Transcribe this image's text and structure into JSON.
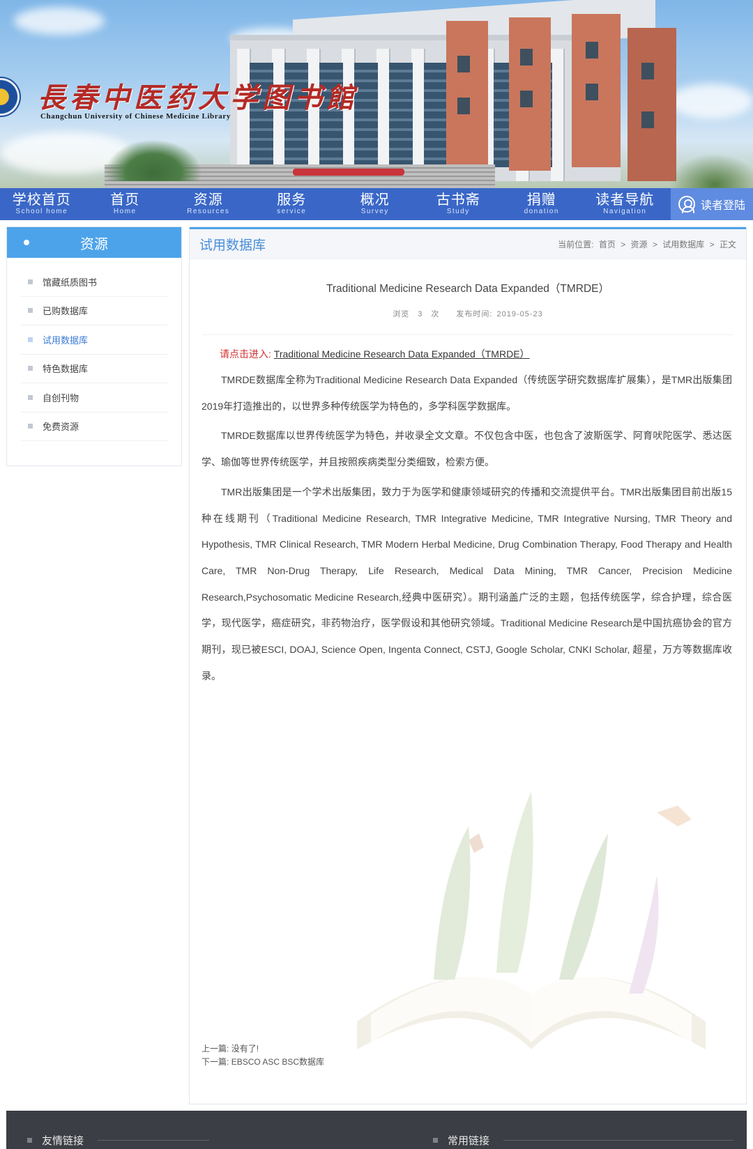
{
  "header": {
    "logo_title": "長春中医药大学图书館",
    "logo_subtitle": "Changchun University of Chinese Medicine Library"
  },
  "nav": {
    "items": [
      {
        "zh": "学校首页",
        "en": "School home"
      },
      {
        "zh": "首页",
        "en": "Home"
      },
      {
        "zh": "资源",
        "en": "Resources"
      },
      {
        "zh": "服务",
        "en": "service"
      },
      {
        "zh": "概况",
        "en": "Survey"
      },
      {
        "zh": "古书斋",
        "en": "Study"
      },
      {
        "zh": "捐赠",
        "en": "donation"
      },
      {
        "zh": "读者导航",
        "en": "Navigation"
      }
    ],
    "login_label": "读者登陆"
  },
  "sidebar": {
    "title": "资源",
    "items": [
      {
        "label": "馆藏纸质图书"
      },
      {
        "label": "已购数据库"
      },
      {
        "label": "试用数据库"
      },
      {
        "label": "特色数据库"
      },
      {
        "label": "自创刊物"
      },
      {
        "label": "免费资源"
      }
    ],
    "active_index": 2
  },
  "main": {
    "section_title": "试用数据库",
    "breadcrumb": {
      "label": "当前位置:",
      "home": "首页",
      "sep": ">",
      "resources": "资源",
      "trial_db": "试用数据库",
      "current": "正文"
    },
    "article": {
      "title": "Traditional Medicine Research Data Expanded（TMRDE）",
      "views_label": "浏览",
      "views_count": "3",
      "views_unit": "次",
      "publish_label": "发布时间:",
      "publish_date": "2019-05-23",
      "enter_prompt": "请点击进入:",
      "enter_link": "Traditional Medicine Research Data Expanded（TMRDE）",
      "paragraphs": [
        "TMRDE数据库全称为Traditional Medicine Research Data Expanded（传统医学研究数据库扩展集），是TMR出版集团2019年打造推出的，以世界多种传统医学为特色的，多学科医学数据库。",
        "TMRDE数据库以世界传统医学为特色，并收录全文文章。不仅包含中医，也包含了波斯医学、阿育吠陀医学、悉达医学、瑜伽等世界传统医学，并且按照疾病类型分类细致，检索方便。",
        "TMR出版集团是一个学术出版集团，致力于为医学和健康领域研究的传播和交流提供平台。TMR出版集团目前出版15种在线期刊（Traditional Medicine Research, TMR Integrative Medicine, TMR Integrative Nursing, TMR Theory and Hypothesis, TMR Clinical Research, TMR Modern Herbal Medicine, Drug Combination Therapy, Food Therapy and Health Care, TMR Non-Drug Therapy, Life Research, Medical Data Mining, TMR Cancer, Precision Medicine Research,Psychosomatic Medicine Research,经典中医研究）。期刊涵盖广泛的主题，包括传统医学，综合护理，综合医学，现代医学，癌症研究，非药物治疗，医学假设和其他研究领域。Traditional Medicine Research是中国抗癌协会的官方期刊，现已被ESCI, DOAJ, Science Open, Ingenta Connect, CSTJ, Google Scholar, CNKI Scholar, 超星，万方等数据库收录。"
      ]
    },
    "pager": {
      "prev_label": "上一篇:",
      "prev_title": "没有了!",
      "next_label": "下一篇:",
      "next_title": "EBSCO ASC BSC数据库"
    }
  },
  "footer": {
    "friend_links": "友情链接",
    "common_links": "常用链接"
  },
  "colors": {
    "nav_bg": "#3a67c7",
    "accent_blue": "#4da3ea",
    "footer_bg": "#3b3e44",
    "logo_red": "#b52a25"
  }
}
